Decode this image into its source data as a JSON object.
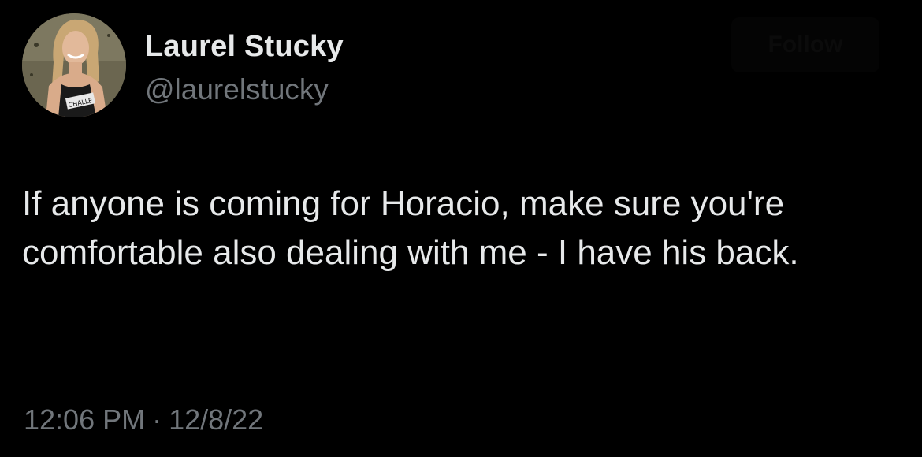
{
  "author": {
    "display_name": "Laurel Stucky",
    "handle": "@laurelstucky",
    "avatar_icon": "profile-photo-avatar"
  },
  "follow_button": {
    "label": "Follow"
  },
  "tweet": {
    "text": "If anyone is coming for Horacio, make sure you're comfortable also dealing with me - I have his back."
  },
  "meta": {
    "time": "12:06 PM",
    "separator": "·",
    "date": "12/8/22"
  },
  "colors": {
    "background": "#000000",
    "primary_text": "#e7e9ea",
    "secondary_text": "#71767b"
  }
}
